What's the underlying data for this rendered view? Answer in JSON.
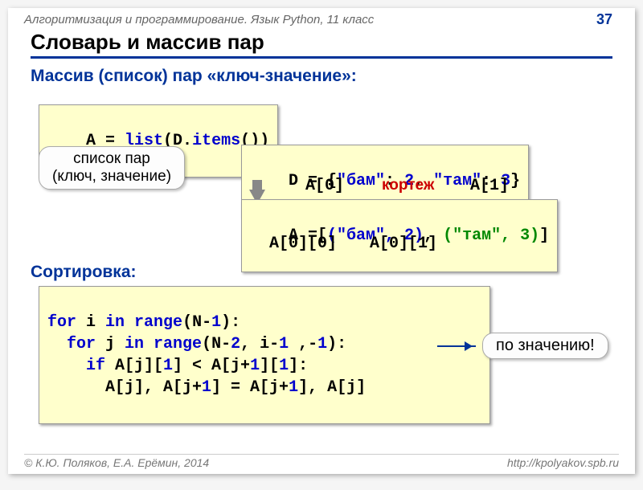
{
  "header": {
    "course": "Алгоритмизация и программирование. Язык Python, 11 класс",
    "page": "37"
  },
  "title": "Словарь и массив пар",
  "section1": "Массив (список) пар «ключ-значение»:",
  "code1": {
    "t1": "A = ",
    "t2": "list",
    "t3": "(D.",
    "t4": "items",
    "t5": "())"
  },
  "callout1_l1": "список пар",
  "callout1_l2": "(ключ, значение)",
  "code2": {
    "t1": "D = {",
    "t2": "\"бам\"",
    "t3": ": ",
    "t4": "2",
    "t5": ", ",
    "t6": "\"там\"",
    "t7": ": ",
    "t8": "3",
    "t9": "}"
  },
  "tuple_label": "кортеж",
  "idx0": "A[0]",
  "idx1": "A[1]",
  "idx00": "A[0][0]",
  "idx01": "A[0][1]",
  "code3": {
    "t1": "A =[",
    "t2": "(\"бам\", 2)",
    "t3": ", ",
    "t4": "(\"там\", 3)",
    "t5": "]"
  },
  "section2": "Сортировка:",
  "code4": {
    "l1a": "for",
    "l1b": " i ",
    "l1c": "in",
    "l1d": " range",
    "l1e": "(N-",
    "l1f": "1",
    "l1g": "):",
    "l2a": "  for",
    "l2b": " j ",
    "l2c": "in",
    "l2d": " range",
    "l2e": "(N-",
    "l2f": "2",
    "l2g": ", i-",
    "l2h": "1",
    "l2i": " ,-",
    "l2j": "1",
    "l2k": "):",
    "l3a": "    if",
    "l3b": " A[j][",
    "l3c": "1",
    "l3d": "] < A[j+",
    "l3e": "1",
    "l3f": "][",
    "l3g": "1",
    "l3h": "]:",
    "l4a": "      A[j], A[j+",
    "l4b": "1",
    "l4c": "] = A[j+",
    "l4d": "1",
    "l4e": "], A[j]"
  },
  "callout2": "по значению!",
  "footer": {
    "left": "© К.Ю. Поляков, Е.А. Ерёмин, 2014",
    "right": "http://kpolyakov.spb.ru"
  }
}
